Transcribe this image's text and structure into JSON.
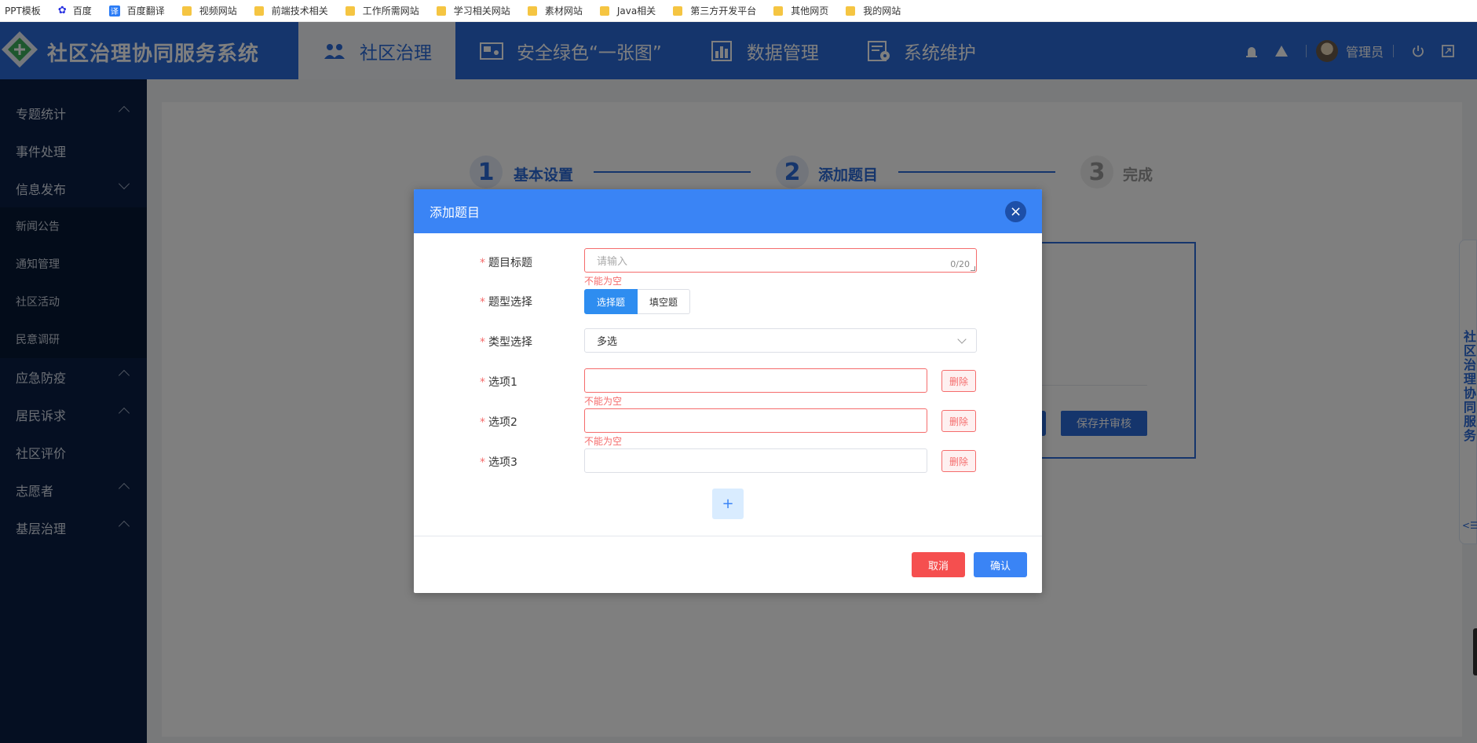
{
  "bookmarks": [
    "PPT模板",
    "百度",
    "百度翻译",
    "视频网站",
    "前端技术相关",
    "工作所需网站",
    "学习相关网站",
    "素材网站",
    "Java相关",
    "第三方开发平台",
    "其他网页",
    "我的网站"
  ],
  "header": {
    "app_title": "社区治理协同服务系统",
    "tabs": [
      {
        "label": "社区治理",
        "icon": "community-icon"
      },
      {
        "label": "安全绿色“一张图”",
        "icon": "map-icon"
      },
      {
        "label": "数据管理",
        "icon": "chart-icon"
      },
      {
        "label": "系统维护",
        "icon": "maintenance-icon"
      }
    ],
    "user": "管理员"
  },
  "sidebar": {
    "items": [
      {
        "label": "专题统计"
      },
      {
        "label": "事件处理"
      },
      {
        "label": "信息发布"
      },
      {
        "label": "应急防疫"
      },
      {
        "label": "居民诉求"
      },
      {
        "label": "社区评价"
      },
      {
        "label": "志愿者"
      },
      {
        "label": "基层治理"
      }
    ],
    "sub_items": [
      "新闻公告",
      "通知管理",
      "社区活动",
      "民意调研"
    ]
  },
  "steps": [
    {
      "num": "1",
      "label": "基本设置"
    },
    {
      "num": "2",
      "label": "添加题目"
    },
    {
      "num": "3",
      "label": "完成"
    }
  ],
  "background": {
    "save_button": "保存并审核",
    "side_float_text": "社区治理协同服务",
    "side_float_mini": "<☰"
  },
  "dialog": {
    "title": "添加题目",
    "close": "×",
    "fields": {
      "title_label": "题目标题",
      "title_placeholder": "请输入",
      "title_counter": "0/20",
      "type_label": "题型选择",
      "type_options": [
        "选择题",
        "填空题"
      ],
      "kind_label": "类型选择",
      "kind_value": "多选",
      "options": [
        {
          "label": "选项1",
          "value": ""
        },
        {
          "label": "选项2",
          "value": ""
        },
        {
          "label": "选项3",
          "value": ""
        }
      ]
    },
    "error_text": "不能为空",
    "delete_label": "删除",
    "add_label": "+",
    "cancel_label": "取消",
    "ok_label": "确认"
  }
}
